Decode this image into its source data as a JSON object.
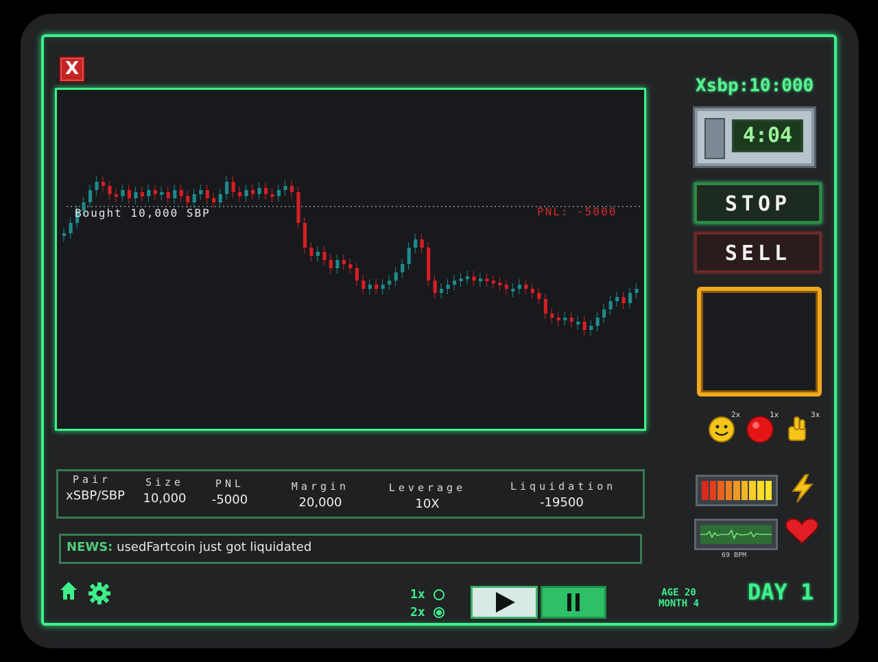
{
  "window": {
    "close_symbol": "X"
  },
  "balance": "Xsbp:10:000",
  "timer": "4:04",
  "buttons": {
    "stop": "STOP",
    "sell": "SELL"
  },
  "powerups": [
    {
      "name": "smiley-face",
      "count": "2x"
    },
    {
      "name": "red-button",
      "count": "1x"
    },
    {
      "name": "finger-cross",
      "count": "3x"
    }
  ],
  "vitals": {
    "bpm": "69 BPM",
    "energy_level": 1.0
  },
  "chart_data": {
    "type": "candlestick",
    "annotations": {
      "entry": "Bought 10,000 SBP",
      "pnl": "PNL: -5000"
    },
    "entry_price_norm": 0.5,
    "candles": [
      0.37,
      0.42,
      0.48,
      0.52,
      0.58,
      0.62,
      0.6,
      0.56,
      0.55,
      0.58,
      0.54,
      0.57,
      0.55,
      0.58,
      0.56,
      0.57,
      0.54,
      0.58,
      0.55,
      0.52,
      0.56,
      0.58,
      0.54,
      0.52,
      0.56,
      0.62,
      0.57,
      0.55,
      0.58,
      0.56,
      0.59,
      0.56,
      0.55,
      0.58,
      0.6,
      0.57,
      0.42,
      0.3,
      0.26,
      0.28,
      0.24,
      0.2,
      0.24,
      0.22,
      0.2,
      0.14,
      0.1,
      0.12,
      0.1,
      0.12,
      0.14,
      0.18,
      0.22,
      0.3,
      0.34,
      0.3,
      0.14,
      0.08,
      0.1,
      0.12,
      0.14,
      0.15,
      0.16,
      0.14,
      0.15,
      0.14,
      0.13,
      0.12,
      0.1,
      0.1,
      0.12,
      0.1,
      0.08,
      0.05,
      -0.02,
      -0.04,
      -0.05,
      -0.04,
      -0.06,
      -0.06,
      -0.1,
      -0.08,
      -0.04,
      0.0,
      0.04,
      0.06,
      0.03,
      0.08,
      0.1
    ]
  },
  "position": {
    "headers": [
      "Pair",
      "Size",
      "PNL",
      "Margin",
      "Leverage",
      "Liquidation"
    ],
    "values": [
      "xSBP/SBP",
      "10,000",
      "-5000",
      "20,000",
      "10X",
      "-19500"
    ]
  },
  "news": {
    "tag": "NEWS:",
    "text": "usedFartcoin just got liquidated"
  },
  "speed": {
    "option1": "1x",
    "option2": "2x",
    "selected": "2x"
  },
  "stats": {
    "age": "AGE 20",
    "month": "MONTH 4",
    "day": "DAY 1"
  },
  "colors": {
    "accent": "#3df08a",
    "up": "#1f8a8c",
    "down": "#d51f24"
  }
}
